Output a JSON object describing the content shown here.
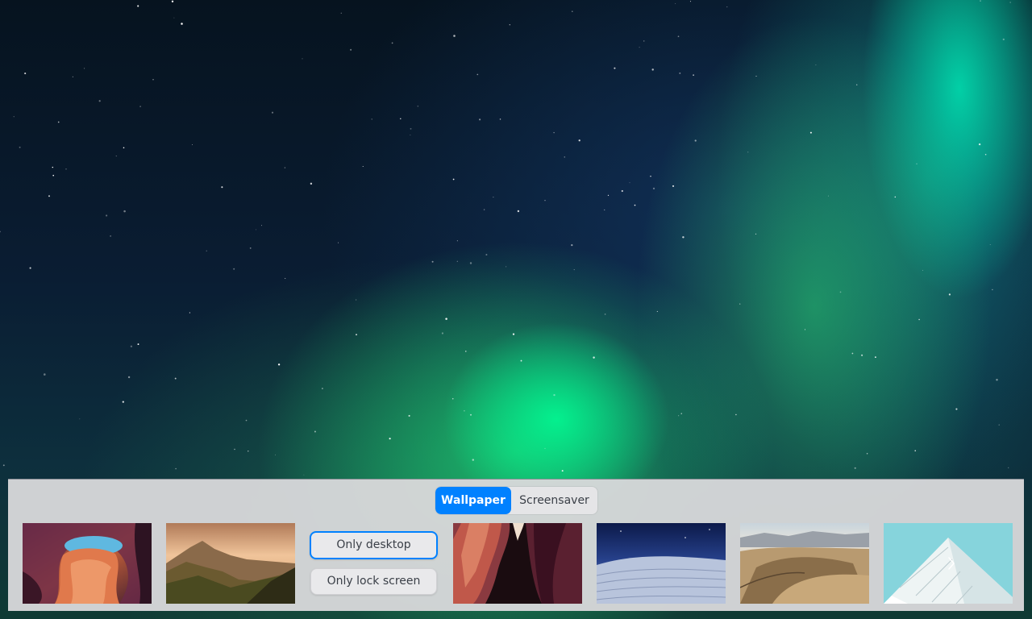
{
  "tabs": {
    "wallpaper_label": "Wallpaper",
    "screensaver_label": "Screensaver",
    "active": "Wallpaper"
  },
  "apply_options": {
    "desktop_label": "Only desktop",
    "lock_screen_label": "Only lock screen"
  },
  "thumbnails": [
    {
      "name": "canyon-arch"
    },
    {
      "name": "mountain-sunset"
    },
    {
      "name": "red-slot-canyon"
    },
    {
      "name": "white-dunes-night"
    },
    {
      "name": "desert-dunes"
    },
    {
      "name": "white-architecture"
    }
  ],
  "icons": {
    "next": "chevron-right-icon"
  },
  "colors": {
    "accent": "#0081ff",
    "panel_bg": "#d7d7da",
    "text": "#3a3f47"
  }
}
